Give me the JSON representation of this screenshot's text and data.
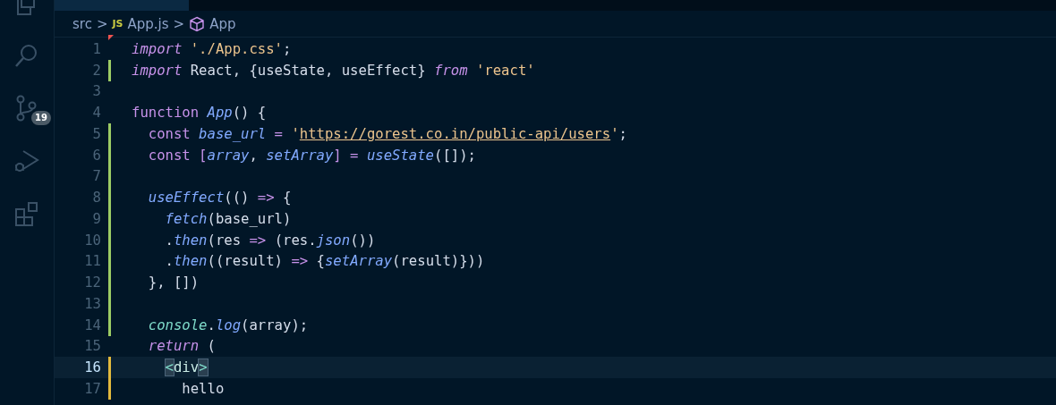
{
  "activity_bar": {
    "items": [
      {
        "kind": "explorer",
        "selected": false
      },
      {
        "kind": "search",
        "selected": false
      },
      {
        "kind": "source-control",
        "selected": false,
        "badge": "19"
      },
      {
        "kind": "run-debug",
        "selected": false
      },
      {
        "kind": "extensions",
        "selected": false
      }
    ]
  },
  "breadcrumb": {
    "items": [
      {
        "kind": "folder",
        "label": "src"
      },
      {
        "kind": "js-file",
        "badge": "JS",
        "label": "App.js"
      },
      {
        "kind": "symbol",
        "label": "App"
      }
    ],
    "separator": ">"
  },
  "editor": {
    "lines": [
      {
        "number": "1",
        "kind": "deleted",
        "active": false,
        "tokens": [
          {
            "kind": "keyword",
            "text": "import "
          },
          {
            "kind": "string",
            "text": "'./App.css'"
          },
          {
            "kind": "plain",
            "text": ";"
          }
        ]
      },
      {
        "number": "2",
        "kind": "added",
        "active": false,
        "tokens": [
          {
            "kind": "keyword",
            "text": "import"
          },
          {
            "kind": "plain",
            "text": " React, {useState, useEffect} "
          },
          {
            "kind": "keyword",
            "text": "from "
          },
          {
            "kind": "string",
            "text": "'react'"
          }
        ]
      },
      {
        "number": "3",
        "kind": "unchanged",
        "active": false
      },
      {
        "number": "4",
        "kind": "unchanged",
        "active": false,
        "tokens": [
          {
            "kind": "storage",
            "text": "function "
          },
          {
            "kind": "func",
            "text": "App"
          },
          {
            "kind": "plain",
            "text": "() {"
          }
        ]
      },
      {
        "number": "5",
        "kind": "added",
        "active": false,
        "tokens": [
          {
            "kind": "storage",
            "text": "  const "
          },
          {
            "kind": "variable",
            "text": "base_url"
          },
          {
            "kind": "punct",
            "text": " = "
          },
          {
            "kind": "string",
            "text": "'"
          },
          {
            "kind": "url",
            "text": "https://gorest.co.in/public-api/users"
          },
          {
            "kind": "string",
            "text": "'"
          },
          {
            "kind": "plain",
            "text": ";"
          }
        ]
      },
      {
        "number": "6",
        "kind": "added",
        "active": false,
        "tokens": [
          {
            "kind": "storage",
            "text": "  const "
          },
          {
            "kind": "bracket",
            "text": "["
          },
          {
            "kind": "variable",
            "text": "array"
          },
          {
            "kind": "plain",
            "text": ", "
          },
          {
            "kind": "variable",
            "text": "setArray"
          },
          {
            "kind": "bracket",
            "text": "]"
          },
          {
            "kind": "punct",
            "text": " = "
          },
          {
            "kind": "func",
            "text": "useState"
          },
          {
            "kind": "plain",
            "text": "([]);"
          }
        ]
      },
      {
        "number": "7",
        "kind": "added",
        "active": false
      },
      {
        "number": "8",
        "kind": "added",
        "active": false,
        "tokens": [
          {
            "kind": "func",
            "text": "  useEffect"
          },
          {
            "kind": "plain",
            "text": "(() "
          },
          {
            "kind": "punct",
            "text": "=>"
          },
          {
            "kind": "plain",
            "text": " {"
          }
        ]
      },
      {
        "number": "9",
        "kind": "added",
        "active": false,
        "tokens": [
          {
            "kind": "func",
            "text": "    fetch"
          },
          {
            "kind": "plain",
            "text": "(base_url)"
          }
        ]
      },
      {
        "number": "10",
        "kind": "added",
        "active": false,
        "tokens": [
          {
            "kind": "plain",
            "text": "    ."
          },
          {
            "kind": "func",
            "text": "then"
          },
          {
            "kind": "plain",
            "text": "(res "
          },
          {
            "kind": "punct",
            "text": "=>"
          },
          {
            "kind": "plain",
            "text": " (res."
          },
          {
            "kind": "func",
            "text": "json"
          },
          {
            "kind": "plain",
            "text": "())"
          }
        ]
      },
      {
        "number": "11",
        "kind": "added",
        "active": false,
        "tokens": [
          {
            "kind": "plain",
            "text": "    ."
          },
          {
            "kind": "func",
            "text": "then"
          },
          {
            "kind": "plain",
            "text": "((result) "
          },
          {
            "kind": "punct",
            "text": "=>"
          },
          {
            "kind": "plain",
            "text": " {"
          },
          {
            "kind": "func",
            "text": "setArray"
          },
          {
            "kind": "plain",
            "text": "(result)}))"
          }
        ]
      },
      {
        "number": "12",
        "kind": "added",
        "active": false,
        "tokens": [
          {
            "kind": "plain",
            "text": "  }, [])"
          }
        ]
      },
      {
        "number": "13",
        "kind": "added",
        "active": false
      },
      {
        "number": "14",
        "kind": "added",
        "active": false,
        "tokens": [
          {
            "kind": "object",
            "text": "  console"
          },
          {
            "kind": "plain",
            "text": "."
          },
          {
            "kind": "func",
            "text": "log"
          },
          {
            "kind": "plain",
            "text": "(array);"
          }
        ]
      },
      {
        "number": "15",
        "kind": "unchanged",
        "active": false,
        "tokens": [
          {
            "kind": "keyword",
            "text": "  return"
          },
          {
            "kind": "plain",
            "text": " ("
          }
        ]
      },
      {
        "number": "16",
        "kind": "modified",
        "active": true,
        "tokens": [
          {
            "kind": "bracket-match",
            "text": "    <"
          },
          {
            "kind": "tag",
            "text": "div"
          },
          {
            "kind": "bracket-match",
            "text": ">"
          }
        ]
      },
      {
        "number": "17",
        "kind": "modified",
        "active": false,
        "tokens": [
          {
            "kind": "plain",
            "text": "      hello"
          }
        ]
      }
    ]
  }
}
